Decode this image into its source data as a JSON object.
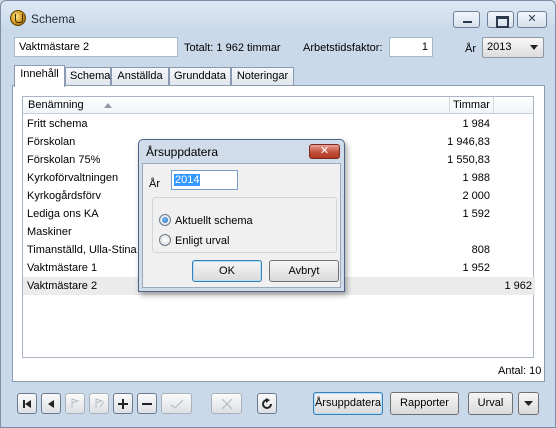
{
  "window": {
    "title": "Schema"
  },
  "header": {
    "name_value": "Vaktmästare 2",
    "total_text": "Totalt: 1 962 timmar",
    "factor_label": "Arbetstidsfaktor:",
    "factor_value": "1",
    "year_label": "År",
    "year_value": "2013"
  },
  "tabs": [
    {
      "label": "Innehåll",
      "active": true
    },
    {
      "label": "Schema"
    },
    {
      "label": "Anställda"
    },
    {
      "label": "Grunddata"
    },
    {
      "label": "Noteringar"
    }
  ],
  "grid": {
    "col_name": "Benämning",
    "col_hours": "Timmar",
    "rows": [
      {
        "name": "Fritt schema",
        "hours": "1 984"
      },
      {
        "name": "Förskolan",
        "hours": "1 946,83"
      },
      {
        "name": "Förskolan 75%",
        "hours": "1 550,83"
      },
      {
        "name": "Kyrkoförvaltningen",
        "hours": "1 988"
      },
      {
        "name": "Kyrkogårdsförv",
        "hours": "2 000"
      },
      {
        "name": "Lediga ons KA",
        "hours": "1 592"
      },
      {
        "name": "Maskiner",
        "hours": ""
      },
      {
        "name": "Timanställd, Ulla-Stina",
        "hours": "808"
      },
      {
        "name": "Vaktmästare 1",
        "hours": "1 952"
      },
      {
        "name": "Vaktmästare 2",
        "hours": "1 962",
        "selected": true
      }
    ],
    "count_text": "Antal: 10"
  },
  "toolbar": {
    "update_label": "Årsuppdatera",
    "reports_label": "Rapporter",
    "selection_label": "Urval"
  },
  "dialog": {
    "title": "Årsuppdatera",
    "year_label": "År",
    "year_value": "2014",
    "option_current": "Aktuellt schema",
    "option_selection": "Enligt urval",
    "selected_option": "current",
    "ok_label": "OK",
    "cancel_label": "Avbryt"
  }
}
